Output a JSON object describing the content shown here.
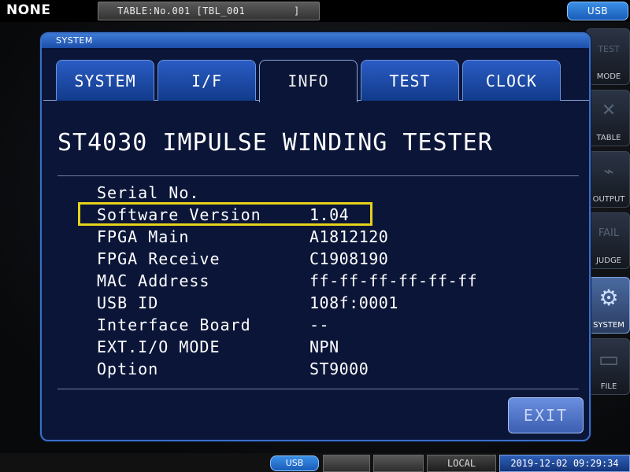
{
  "topbar": {
    "status_label": "NONE",
    "table_label": "TABLE:No.001 [TBL_001        ]",
    "usb_label": "USB"
  },
  "sidebar": {
    "items": [
      {
        "label": "MODE",
        "icon": "test-bdv-mode-icon",
        "symbol": "TEST"
      },
      {
        "label": "TABLE",
        "icon": "table-icon",
        "symbol": "✕"
      },
      {
        "label": "OUTPUT",
        "icon": "output-icon",
        "symbol": "⌁"
      },
      {
        "label": "JUDGE",
        "icon": "pass-fail-judge-icon",
        "symbol": "FAIL"
      },
      {
        "label": "SYSTEM",
        "icon": "gear-icon",
        "symbol": "⚙"
      },
      {
        "label": "FILE",
        "icon": "folder-icon",
        "symbol": "▭"
      }
    ]
  },
  "dialog": {
    "title": "SYSTEM",
    "tabs": [
      {
        "label": "SYSTEM",
        "active": false
      },
      {
        "label": "I/F",
        "active": false
      },
      {
        "label": "INFO",
        "active": true
      },
      {
        "label": "TEST",
        "active": false
      },
      {
        "label": "CLOCK",
        "active": false
      }
    ],
    "heading": "ST4030 IMPULSE WINDING TESTER",
    "info": [
      {
        "label": "Serial No.",
        "value": ""
      },
      {
        "label": "Software Version",
        "value": "1.04"
      },
      {
        "label": "FPGA Main",
        "value": "A1812120"
      },
      {
        "label": "FPGA Receive",
        "value": "C1908190"
      },
      {
        "label": "MAC Address",
        "value": "ff-ff-ff-ff-ff-ff"
      },
      {
        "label": "USB ID",
        "value": "108f:0001"
      },
      {
        "label": "Interface Board",
        "value": "--"
      },
      {
        "label": "EXT.I/O MODE",
        "value": "NPN"
      },
      {
        "label": "Option",
        "value": "ST9000"
      }
    ],
    "highlight_color": "#e6d21a",
    "exit_label": "EXIT"
  },
  "statusbar": {
    "usb_label": "USB",
    "local_label": "LOCAL",
    "datetime": "2019-12-02 09:29:34"
  },
  "colors": {
    "dialog_bg": "#0b1538",
    "tab_blue": "#2a5cc4",
    "accent_blue": "#3a8fe6"
  }
}
